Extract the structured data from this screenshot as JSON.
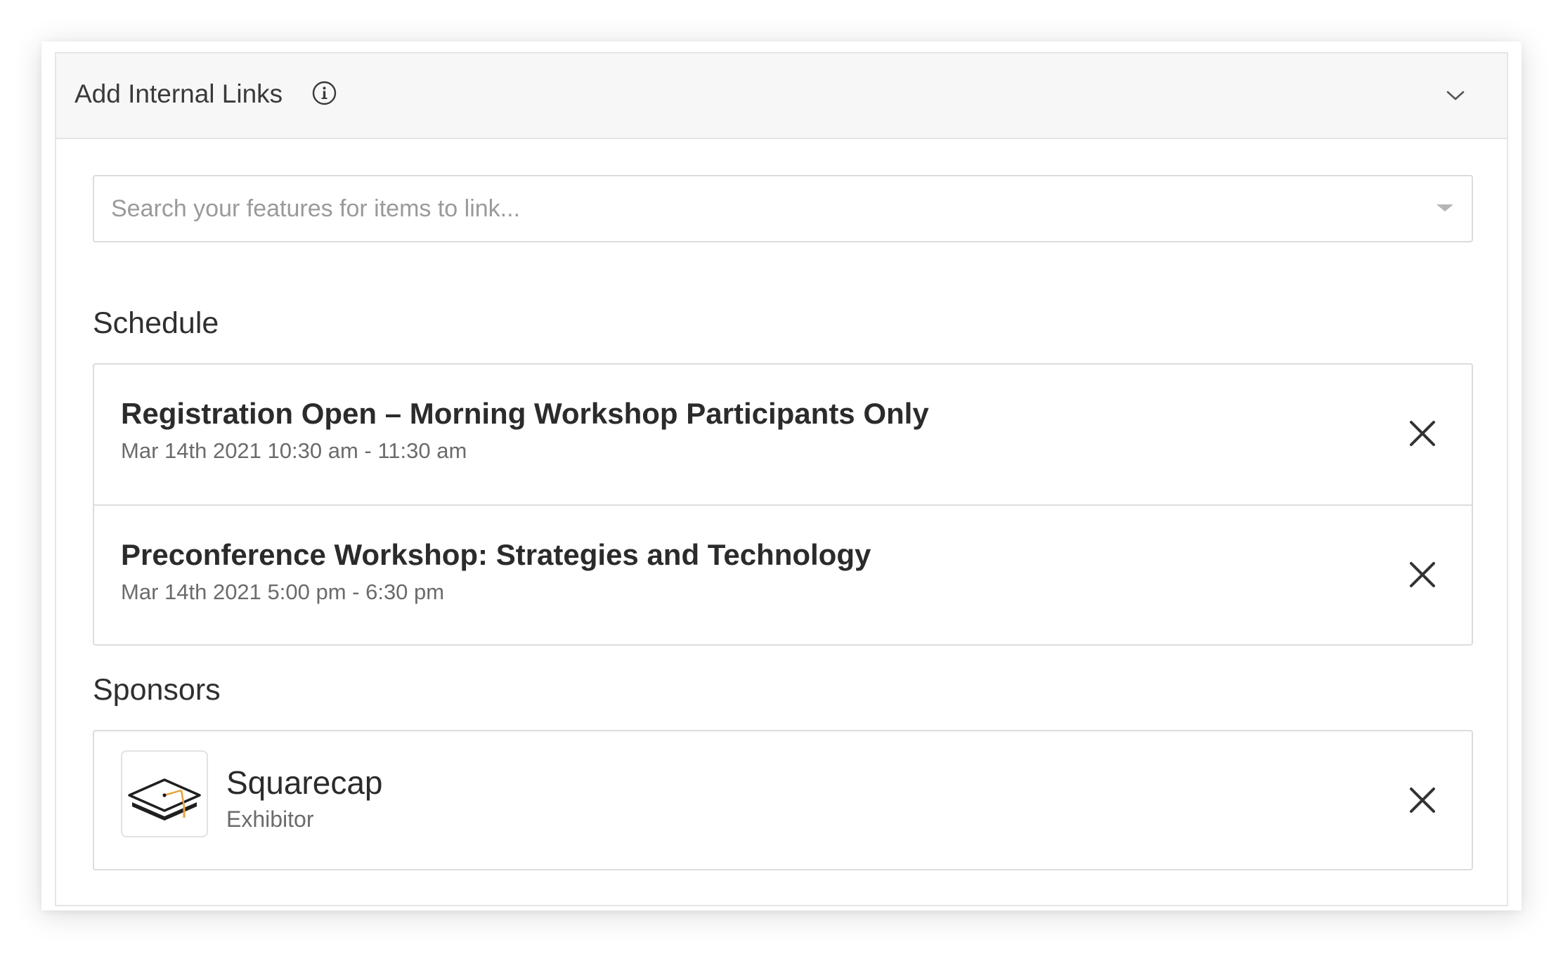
{
  "panel": {
    "title": "Add Internal Links",
    "info_icon": "info-circle-icon",
    "collapse_icon": "chevron-down-icon"
  },
  "search": {
    "placeholder": "Search your features for items to link...",
    "value": "",
    "dropdown_icon": "caret-down-icon"
  },
  "schedule": {
    "heading": "Schedule",
    "items": [
      {
        "title": "Registration Open – Morning Workshop Participants Only",
        "time": "Mar 14th 2021 10:30 am - 11:30 am",
        "remove_icon": "close-icon"
      },
      {
        "title": "Preconference Workshop: Strategies and Technology",
        "time": "Mar 14th 2021 5:00 pm - 6:30 pm",
        "remove_icon": "close-icon"
      }
    ]
  },
  "sponsors": {
    "heading": "Sponsors",
    "items": [
      {
        "name": "Squarecap",
        "type": "Exhibitor",
        "logo_icon": "graduation-cap-icon",
        "remove_icon": "close-icon"
      }
    ]
  },
  "colors": {
    "header_bg": "#f7f7f7",
    "border": "#dcdcdc",
    "text_primary": "#2b2b2b",
    "text_secondary": "#6b6b6b",
    "placeholder": "#9a9a9a",
    "logo_accent": "#e8a33a"
  }
}
